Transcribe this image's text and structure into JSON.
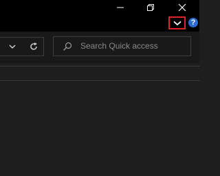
{
  "window": {
    "minimize_icon": "minimize-icon",
    "restore_icon": "restore-icon",
    "close_icon": "close-icon",
    "ribbon_toggle_icon": "chevron-down-icon",
    "help_label": "?"
  },
  "address_bar": {
    "dropdown_icon": "chevron-down-icon",
    "refresh_icon": "refresh-icon"
  },
  "search": {
    "placeholder": "Search Quick access",
    "icon": "search-icon"
  },
  "colors": {
    "titlebar": "#000000",
    "background": "#1e1e1e",
    "highlight": "#e0222a",
    "help": "#2b6cd4"
  }
}
